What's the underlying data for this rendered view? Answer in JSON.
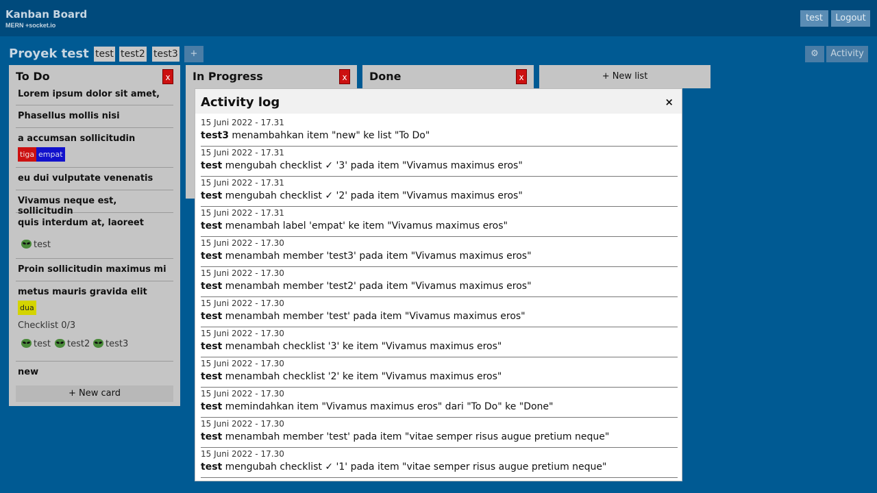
{
  "header": {
    "app_title": "Kanban Board",
    "app_subtitle": "MERN +socket.io",
    "user_label": "test",
    "logout_label": "Logout"
  },
  "board": {
    "title": "Proyek test",
    "members": [
      "test",
      "test2",
      "test3"
    ],
    "add_member_label": "+",
    "settings_icon": "⚙",
    "activity_label": "Activity"
  },
  "lists": {
    "todo": {
      "title": "To Do",
      "delete_label": "x",
      "new_card_label": "+ New card",
      "cards": [
        {
          "title": "Lorem ipsum dolor sit amet,"
        },
        {
          "title": "Phasellus mollis nisi"
        },
        {
          "title": "a accumsan sollicitudin",
          "labels": [
            "tiga",
            "empat"
          ]
        },
        {
          "title": "eu dui vulputate venenatis"
        },
        {
          "title": "Vivamus neque est, sollicitudin"
        },
        {
          "title": "quis interdum at, laoreet",
          "members": [
            "test"
          ]
        },
        {
          "title": "Proin sollicitudin maximus mi"
        },
        {
          "title": "metus mauris gravida elit",
          "labels": [
            "dua"
          ],
          "checklist": "Checklist 0/3",
          "members": [
            "test",
            "test2",
            "test3"
          ]
        },
        {
          "title": "new"
        }
      ]
    },
    "in_progress": {
      "title": "In Progress",
      "delete_label": "x"
    },
    "done": {
      "title": "Done",
      "delete_label": "x"
    },
    "new_list_label": "+ New list"
  },
  "label_colors": {
    "tiga": "#cc1111",
    "empat": "#1111cc",
    "dua": "#d4d400"
  },
  "activity_log": {
    "title": "Activity log",
    "close_label": "×",
    "entries": [
      {
        "time": "15 Juni 2022 - 17.31",
        "user": "test3",
        "text": " menambahkan item \"new\" ke list \"To Do\""
      },
      {
        "time": "15 Juni 2022 - 17.31",
        "user": "test",
        "text": " mengubah checklist ✓ '3' pada item \"Vivamus maximus eros\""
      },
      {
        "time": "15 Juni 2022 - 17.31",
        "user": "test",
        "text": " mengubah checklist ✓ '2' pada item \"Vivamus maximus eros\""
      },
      {
        "time": "15 Juni 2022 - 17.31",
        "user": "test",
        "text": " menambah label 'empat' ke item \"Vivamus maximus eros\""
      },
      {
        "time": "15 Juni 2022 - 17.30",
        "user": "test",
        "text": " menambah member 'test3' pada item \"Vivamus maximus eros\""
      },
      {
        "time": "15 Juni 2022 - 17.30",
        "user": "test",
        "text": " menambah member 'test2' pada item \"Vivamus maximus eros\""
      },
      {
        "time": "15 Juni 2022 - 17.30",
        "user": "test",
        "text": " menambah member 'test' pada item \"Vivamus maximus eros\""
      },
      {
        "time": "15 Juni 2022 - 17.30",
        "user": "test",
        "text": " menambah checklist '3' ke item \"Vivamus maximus eros\""
      },
      {
        "time": "15 Juni 2022 - 17.30",
        "user": "test",
        "text": " menambah checklist '2' ke item \"Vivamus maximus eros\""
      },
      {
        "time": "15 Juni 2022 - 17.30",
        "user": "test",
        "text": " memindahkan item \"Vivamus maximus eros\" dari \"To Do\" ke \"Done\""
      },
      {
        "time": "15 Juni 2022 - 17.30",
        "user": "test",
        "text": " menambah member 'test' pada item \"vitae semper risus augue pretium neque\""
      },
      {
        "time": "15 Juni 2022 - 17.30",
        "user": "test",
        "text": " mengubah checklist ✓ '1' pada item \"vitae semper risus augue pretium neque\""
      }
    ]
  }
}
